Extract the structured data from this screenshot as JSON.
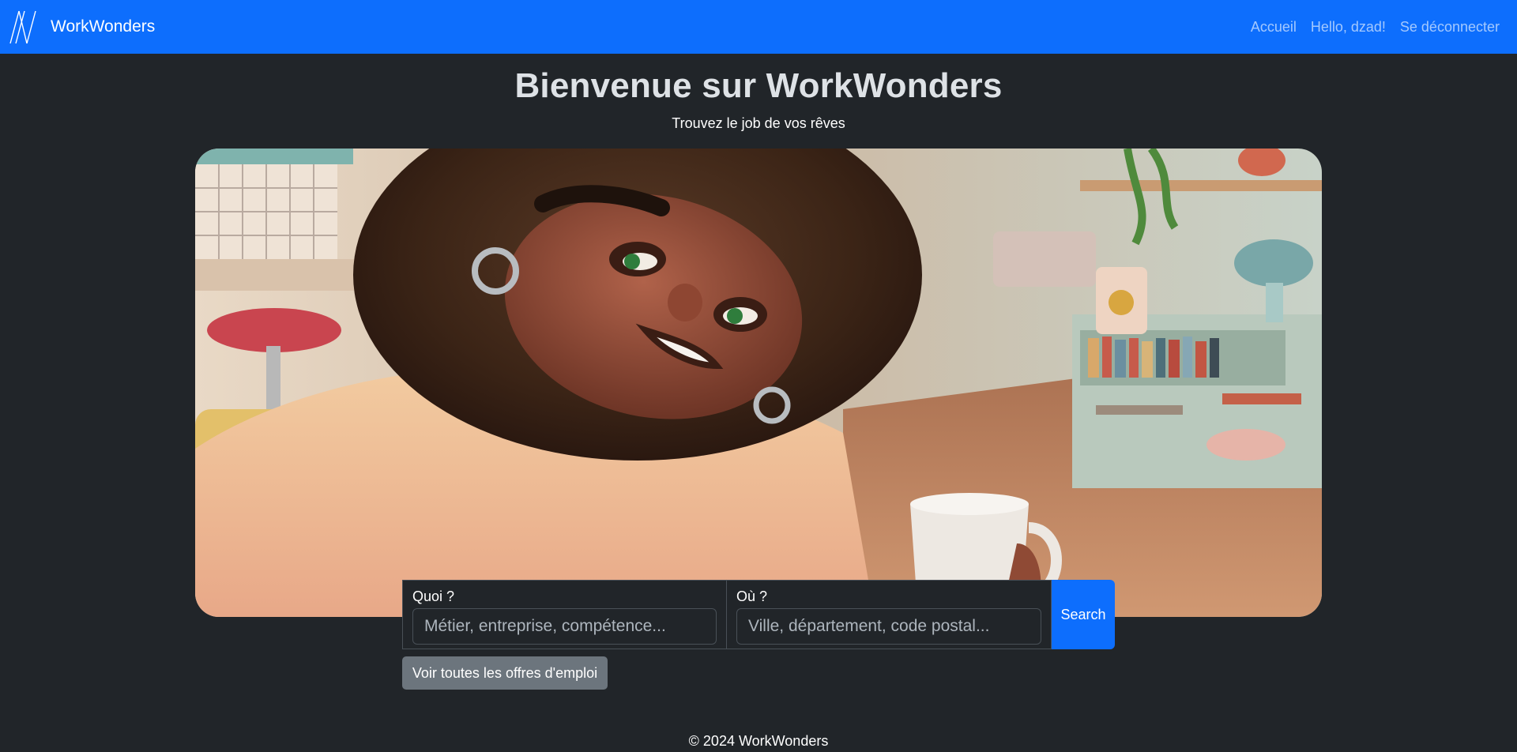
{
  "navbar": {
    "brand": "WorkWonders",
    "links": [
      "Accueil",
      "Hello, dzad!",
      "Se déconnecter"
    ]
  },
  "hero": {
    "title": "Bienvenue sur WorkWonders",
    "subtitle": "Trouvez le job de vos rêves"
  },
  "search": {
    "what_label": "Quoi ?",
    "what_placeholder": "Métier, entreprise, compétence...",
    "where_label": "Où ?",
    "where_placeholder": "Ville, département, code postal...",
    "button": "Search"
  },
  "all_offers_button": "Voir toutes les offres d'emploi",
  "footer": "© 2024 WorkWonders",
  "colors": {
    "primary": "#0d6efd",
    "background": "#212529",
    "secondary": "#6c757d"
  }
}
